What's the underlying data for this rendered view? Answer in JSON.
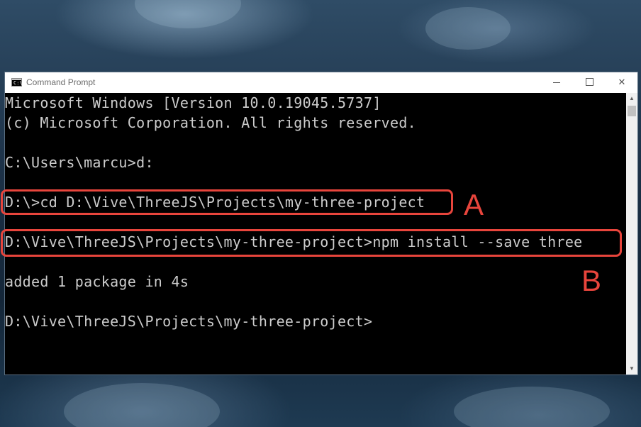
{
  "window": {
    "title": "Command Prompt",
    "icon_text": "C:\\",
    "minimize_label": "",
    "maximize_label": "",
    "close_label": "✕"
  },
  "console": {
    "lines": [
      "Microsoft Windows [Version 10.0.19045.5737]",
      "(c) Microsoft Corporation. All rights reserved.",
      "",
      "C:\\Users\\marcu>d:",
      "",
      "D:\\>cd D:\\Vive\\ThreeJS\\Projects\\my-three-project",
      "",
      "D:\\Vive\\ThreeJS\\Projects\\my-three-project>npm install --save three",
      "",
      "added 1 package in 4s",
      "",
      "D:\\Vive\\ThreeJS\\Projects\\my-three-project>"
    ]
  },
  "annotations": {
    "a_label": "A",
    "b_label": "B",
    "color": "#e8453c"
  },
  "scrollbar": {
    "up_arrow": "▲",
    "down_arrow": "▼"
  }
}
